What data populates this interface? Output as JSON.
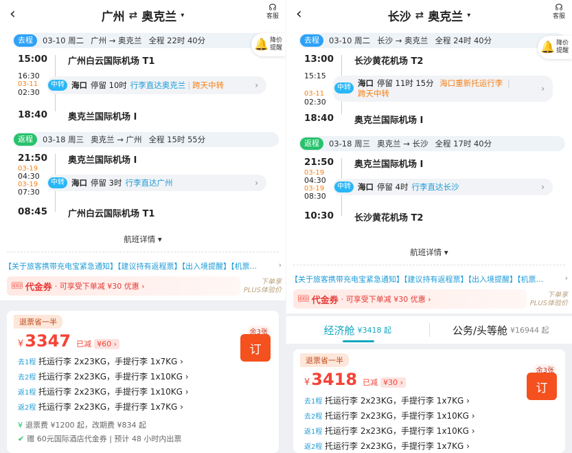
{
  "p1": {
    "title_from": "广州",
    "title_to": "奥克兰",
    "swap": "⇄",
    "caret": "▾",
    "cs": "客服",
    "alert": "降价提醒",
    "out": {
      "tag": "去程",
      "date": "03-10 周二",
      "route": "广州 → 奥克兰",
      "dur": "全程 22时 40分",
      "dep_time": "15:00",
      "dep_ap": "广州白云国际机场 T1",
      "stop_arr": "16:30",
      "stop_date": "03-11",
      "stop_dep": "02:30",
      "stop_badge": "中转",
      "stop_city": "海口",
      "stop_wait": "停留 10时",
      "stop_note": "行李直达奥克兰",
      "stop_sep": "|",
      "stop_cross": "跨天中转",
      "arr_time": "18:40",
      "arr_ap": "奥克兰国际机场 I"
    },
    "ret": {
      "tag": "返程",
      "date": "03-18 周三",
      "route": "奥克兰 → 广州",
      "dur": "全程 15时 55分",
      "dep_time": "21:50",
      "dep_ap": "奥克兰国际机场 I",
      "d1": "03-19",
      "stop_arr": "04:30",
      "d2": "03-19",
      "stop_dep": "07:30",
      "stop_badge": "中转",
      "stop_city": "海口",
      "stop_wait": "停留 3时",
      "stop_note": "行李直达广州",
      "arr_time": "08:45",
      "arr_ap": "广州白云国际机场 T1"
    },
    "details": "航班详情 ▾",
    "notice": "【关于旅客携带充电宝紧急通知】【建议持有返程票】【出入境提醒】【机票...",
    "coupon_title": "代金券",
    "coupon_desc": "· 可享受下单减 ¥30 优惠  ›",
    "plus1": "下单享",
    "plus2": "PLUS体验价",
    "refund": "退票省一半",
    "yen": "¥",
    "price": "3347",
    "reduced": "已减",
    "reduced_amt": "¥60 ›",
    "left": "余3张",
    "book": "订",
    "bags": [
      {
        "t": "去1程",
        "d": "托运行李 2x23KG，手提行李 1x7KG ›"
      },
      {
        "t": "去2程",
        "d": "托运行李 2x23KG，手提行李 1x10KG ›"
      },
      {
        "t": "返1程",
        "d": "托运行李 2x23KG，手提行李 1x10KG ›"
      },
      {
        "t": "返2程",
        "d": "托运行李 2x23KG，手提行李 1x7KG ›"
      }
    ],
    "extra1": "退票费 ¥1200 起，改期费 ¥834 起",
    "extra2": "赠 60元国际酒店代金券 | 预计 48 小时内出票"
  },
  "p2": {
    "title_from": "长沙",
    "title_to": "奥克兰",
    "swap": "⇄",
    "caret": "▾",
    "cs": "客服",
    "alert": "降价提醒",
    "out": {
      "tag": "去程",
      "date": "03-10 周二",
      "route": "长沙 → 奥克兰",
      "dur": "全程 24时 40分",
      "dep_time": "13:00",
      "dep_ap": "长沙黄花机场 T2",
      "stop_arr": "15:15",
      "stop_date": "03-11",
      "stop_dep": "02:30",
      "stop_badge": "中转",
      "stop_city": "海口",
      "stop_wait": "停留 11时 15分",
      "stop_note": "海口重新托运行李",
      "stop_sep": "|",
      "stop_cross": "跨天中转",
      "arr_time": "18:40",
      "arr_ap": "奥克兰国际机场 I"
    },
    "ret": {
      "tag": "返程",
      "date": "03-18 周三",
      "route": "奥克兰 → 长沙",
      "dur": "全程 17时 40分",
      "dep_time": "21:50",
      "dep_ap": "奥克兰国际机场 I",
      "d1": "03-19",
      "stop_arr": "04:30",
      "d2": "03-19",
      "stop_dep": "08:30",
      "stop_badge": "中转",
      "stop_city": "海口",
      "stop_wait": "停留 4时",
      "stop_note": "行李直达长沙",
      "arr_time": "10:30",
      "arr_ap": "长沙黄花机场 T2"
    },
    "details": "航班详情 ▾",
    "notice": "【关于旅客携带充电宝紧急通知】【建议持有返程票】【出入境提醒】【机票...",
    "coupon_title": "代金券",
    "coupon_desc": "· 可享受下单减 ¥30 优惠  ›",
    "plus1": "下单享",
    "plus2": "PLUS体验价",
    "cabin1": "经济舱",
    "cabin1_price": "¥3418 起",
    "cabin2": "公务/头等舱",
    "cabin2_price": "¥16944 起",
    "refund": "退票省一半",
    "yen": "¥",
    "price": "3418",
    "reduced": "已减",
    "reduced_amt": "¥30 ›",
    "left": "余3张",
    "book": "订",
    "bags": [
      {
        "t": "去1程",
        "d": "托运行李 2x23KG，手提行李 1x7KG ›"
      },
      {
        "t": "去2程",
        "d": "托运行李 2x23KG，手提行李 1x10KG ›"
      },
      {
        "t": "返1程",
        "d": "托运行李 2x23KG，手提行李 1x10KG ›"
      },
      {
        "t": "返2程",
        "d": "托运行李 2x23KG，手提行李 1x7KG ›"
      }
    ]
  }
}
